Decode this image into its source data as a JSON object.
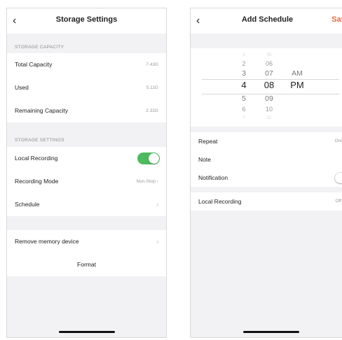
{
  "storage_screen": {
    "title": "Storage Settings",
    "back_glyph": "‹",
    "sections": [
      {
        "header": "STORAGE CAPACITY",
        "rows": [
          {
            "label": "Total Capacity",
            "value": "7.43G"
          },
          {
            "label": "Used",
            "value": "5.11G"
          },
          {
            "label": "Remaining Capacity",
            "value": "2.32G"
          }
        ]
      },
      {
        "header": "STORAGE SETTINGS",
        "rows": [
          {
            "label": "Local Recording",
            "toggle": true
          },
          {
            "label": "Recording Mode",
            "value": "Non-Stop",
            "chevron": "›"
          },
          {
            "label": "Schedule",
            "chevron": "›"
          }
        ]
      }
    ],
    "remove_device": {
      "label": "Remove memory device",
      "chevron": "›"
    },
    "format": {
      "label": "Format"
    }
  },
  "schedule_screen": {
    "title": "Add Schedule",
    "back_glyph": "‹",
    "save_label": "Save",
    "picker": {
      "hours": [
        "1",
        "2",
        "3",
        "4",
        "5",
        "6",
        "7"
      ],
      "minutes": [
        "05",
        "06",
        "07",
        "08",
        "09",
        "10",
        "11"
      ],
      "periods": [
        "AM",
        "PM"
      ],
      "selected": {
        "hour": "4",
        "minute": "08",
        "period": "PM"
      }
    },
    "rows": [
      {
        "label": "Repeat",
        "value": "Once"
      },
      {
        "label": "Note",
        "value": ""
      },
      {
        "label": "Notification",
        "toggle": false
      }
    ],
    "local_recording": {
      "label": "Local Recording",
      "value": "Off"
    }
  },
  "colors": {
    "accent_orange": "#e8683a",
    "toggle_on": "#4cbb5e",
    "toggle_off": "#e3e3e6",
    "screen_bg": "#f2f2f4"
  }
}
